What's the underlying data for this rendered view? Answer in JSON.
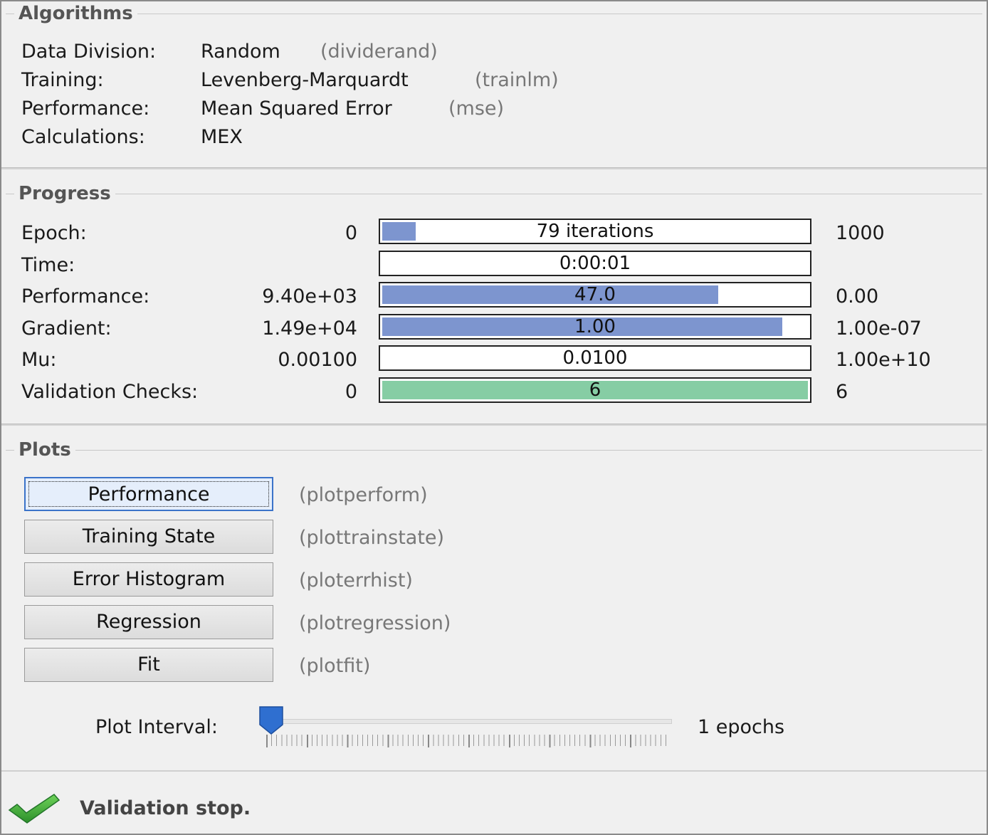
{
  "algorithms": {
    "title": "Algorithms",
    "rows": [
      {
        "label": "Data Division:",
        "value": "Random",
        "code": "(dividerand)"
      },
      {
        "label": "Training:",
        "value": "Levenberg-Marquardt",
        "code": "(trainlm)"
      },
      {
        "label": "Performance:",
        "value": "Mean Squared Error",
        "code": "(mse)"
      },
      {
        "label": "Calculations:",
        "value": "MEX",
        "code": ""
      }
    ]
  },
  "progress": {
    "title": "Progress",
    "rows": [
      {
        "label": "Epoch:",
        "start": "0",
        "bar_text": "79 iterations",
        "end": "1000",
        "fill": 0.079
      },
      {
        "label": "Time:",
        "start": "",
        "bar_text": "0:00:01",
        "end": "",
        "fill": 0
      },
      {
        "label": "Performance:",
        "start": "9.40e+03",
        "bar_text": "47.0",
        "end": "0.00",
        "fill": 0.79
      },
      {
        "label": "Gradient:",
        "start": "1.49e+04",
        "bar_text": "1.00",
        "end": "1.00e-07",
        "fill": 0.94
      },
      {
        "label": "Mu:",
        "start": "0.00100",
        "bar_text": "0.0100",
        "end": "1.00e+10",
        "fill": 0
      },
      {
        "label": "Validation Checks:",
        "start": "0",
        "bar_text": "6",
        "end": "6",
        "fill": 1.0
      }
    ],
    "fill_color": "#7d95cf",
    "validation_color": "#86cda4"
  },
  "plots": {
    "title": "Plots",
    "buttons": [
      {
        "label": "Performance",
        "code": "(plotperform)"
      },
      {
        "label": "Training State",
        "code": "(plottrainstate)"
      },
      {
        "label": "Error Histogram",
        "code": "(ploterrhist)"
      },
      {
        "label": "Regression",
        "code": "(plotregression)"
      },
      {
        "label": "Fit",
        "code": "(plotfit)"
      }
    ],
    "interval_label": "Plot Interval:",
    "interval_value": "1 epochs",
    "slider_fraction": 0.0
  },
  "status": {
    "icon": "checkmark-icon",
    "text": "Validation stop."
  }
}
